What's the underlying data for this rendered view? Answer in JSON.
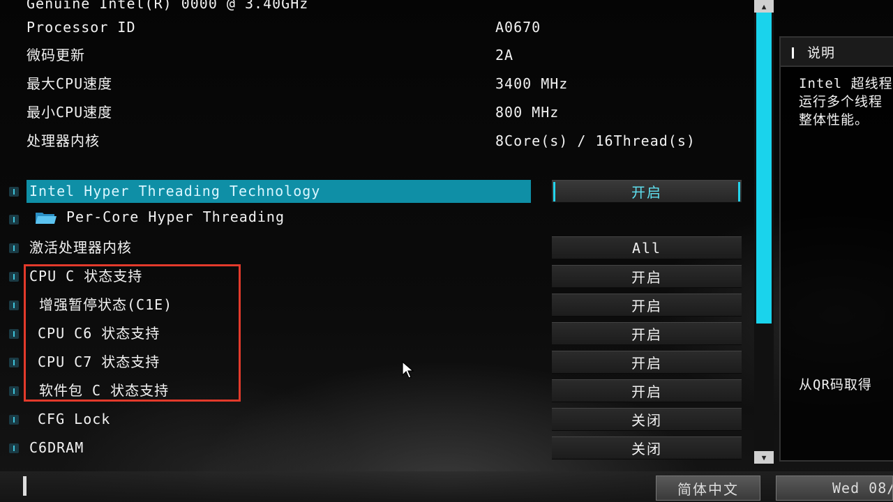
{
  "header": {
    "cpu_name": "Genuine Intel(R) 0000 @ 3.40GHz"
  },
  "info": [
    {
      "label": "Processor ID",
      "value": "A0670"
    },
    {
      "label": "微码更新",
      "value": "2A"
    },
    {
      "label": "最大CPU速度",
      "value": "3400 MHz"
    },
    {
      "label": "最小CPU速度",
      "value": "800 MHz"
    },
    {
      "label": "处理器内核",
      "value": "8Core(s) / 16Thread(s)"
    }
  ],
  "settings": [
    {
      "label": "Intel Hyper Threading Technology",
      "value": "开启"
    },
    {
      "label": "Per-Core Hyper Threading",
      "value": ""
    },
    {
      "label": "激活处理器内核",
      "value": "All"
    },
    {
      "label": "CPU C 状态支持",
      "value": "开启"
    },
    {
      "label": "增强暂停状态(C1E)",
      "value": "开启"
    },
    {
      "label": "CPU C6 状态支持",
      "value": "开启"
    },
    {
      "label": "CPU C7 状态支持",
      "value": "开启"
    },
    {
      "label": "软件包 C 状态支持",
      "value": "开启"
    },
    {
      "label": "CFG Lock",
      "value": "关闭"
    },
    {
      "label": "C6DRAM",
      "value": "关闭"
    }
  ],
  "side_panel": {
    "title": "说明",
    "desc_lines": [
      "Intel 超线程",
      "运行多个线程",
      "整体性能。"
    ],
    "qr_text": "从QR码取得"
  },
  "footer": {
    "language": "简体中文",
    "date": "Wed 08/"
  },
  "colors": {
    "accent": "#1ad3ec",
    "selected_row": "#0f8fa6",
    "highlight_box": "#e33a2b"
  }
}
